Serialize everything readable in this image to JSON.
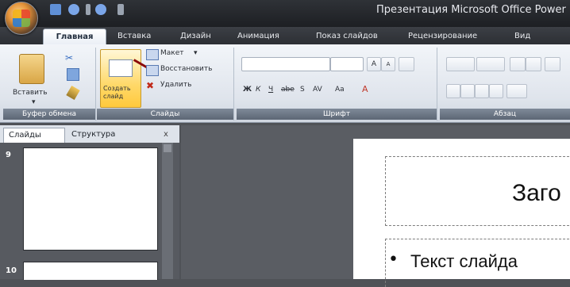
{
  "window": {
    "title": "Презентация Microsoft Office Power"
  },
  "tabs": [
    {
      "label": "Главная"
    },
    {
      "label": "Вставка"
    },
    {
      "label": "Дизайн"
    },
    {
      "label": "Анимация"
    },
    {
      "label": "Показ слайдов"
    },
    {
      "label": "Рецензирование"
    },
    {
      "label": "Вид"
    }
  ],
  "ribbon": {
    "clipboard": {
      "paste_label": "Вставить",
      "group_label": "Буфер обмена"
    },
    "slides": {
      "new_slide_label": "Создать слайд",
      "layout_label": "Макет",
      "reset_label": "Восстановить",
      "delete_label": "Удалить",
      "group_label": "Слайды"
    },
    "font": {
      "bold": "Ж",
      "italic": "К",
      "underline": "Ч",
      "strike": "abe",
      "shadow": "S",
      "spacing": "AV",
      "case": "Aa",
      "grow": "A",
      "shrink": "A",
      "color": "A",
      "group_label": "Шрифт"
    },
    "paragraph": {
      "group_label": "Абзац"
    }
  },
  "pane": {
    "tabs": [
      {
        "label": "Слайды"
      },
      {
        "label": "Структура"
      }
    ],
    "close_glyph": "x",
    "slides": [
      {
        "number": "9"
      },
      {
        "number": "10"
      }
    ]
  },
  "slide": {
    "title": "Заго",
    "bullet": "Текст слайда"
  }
}
